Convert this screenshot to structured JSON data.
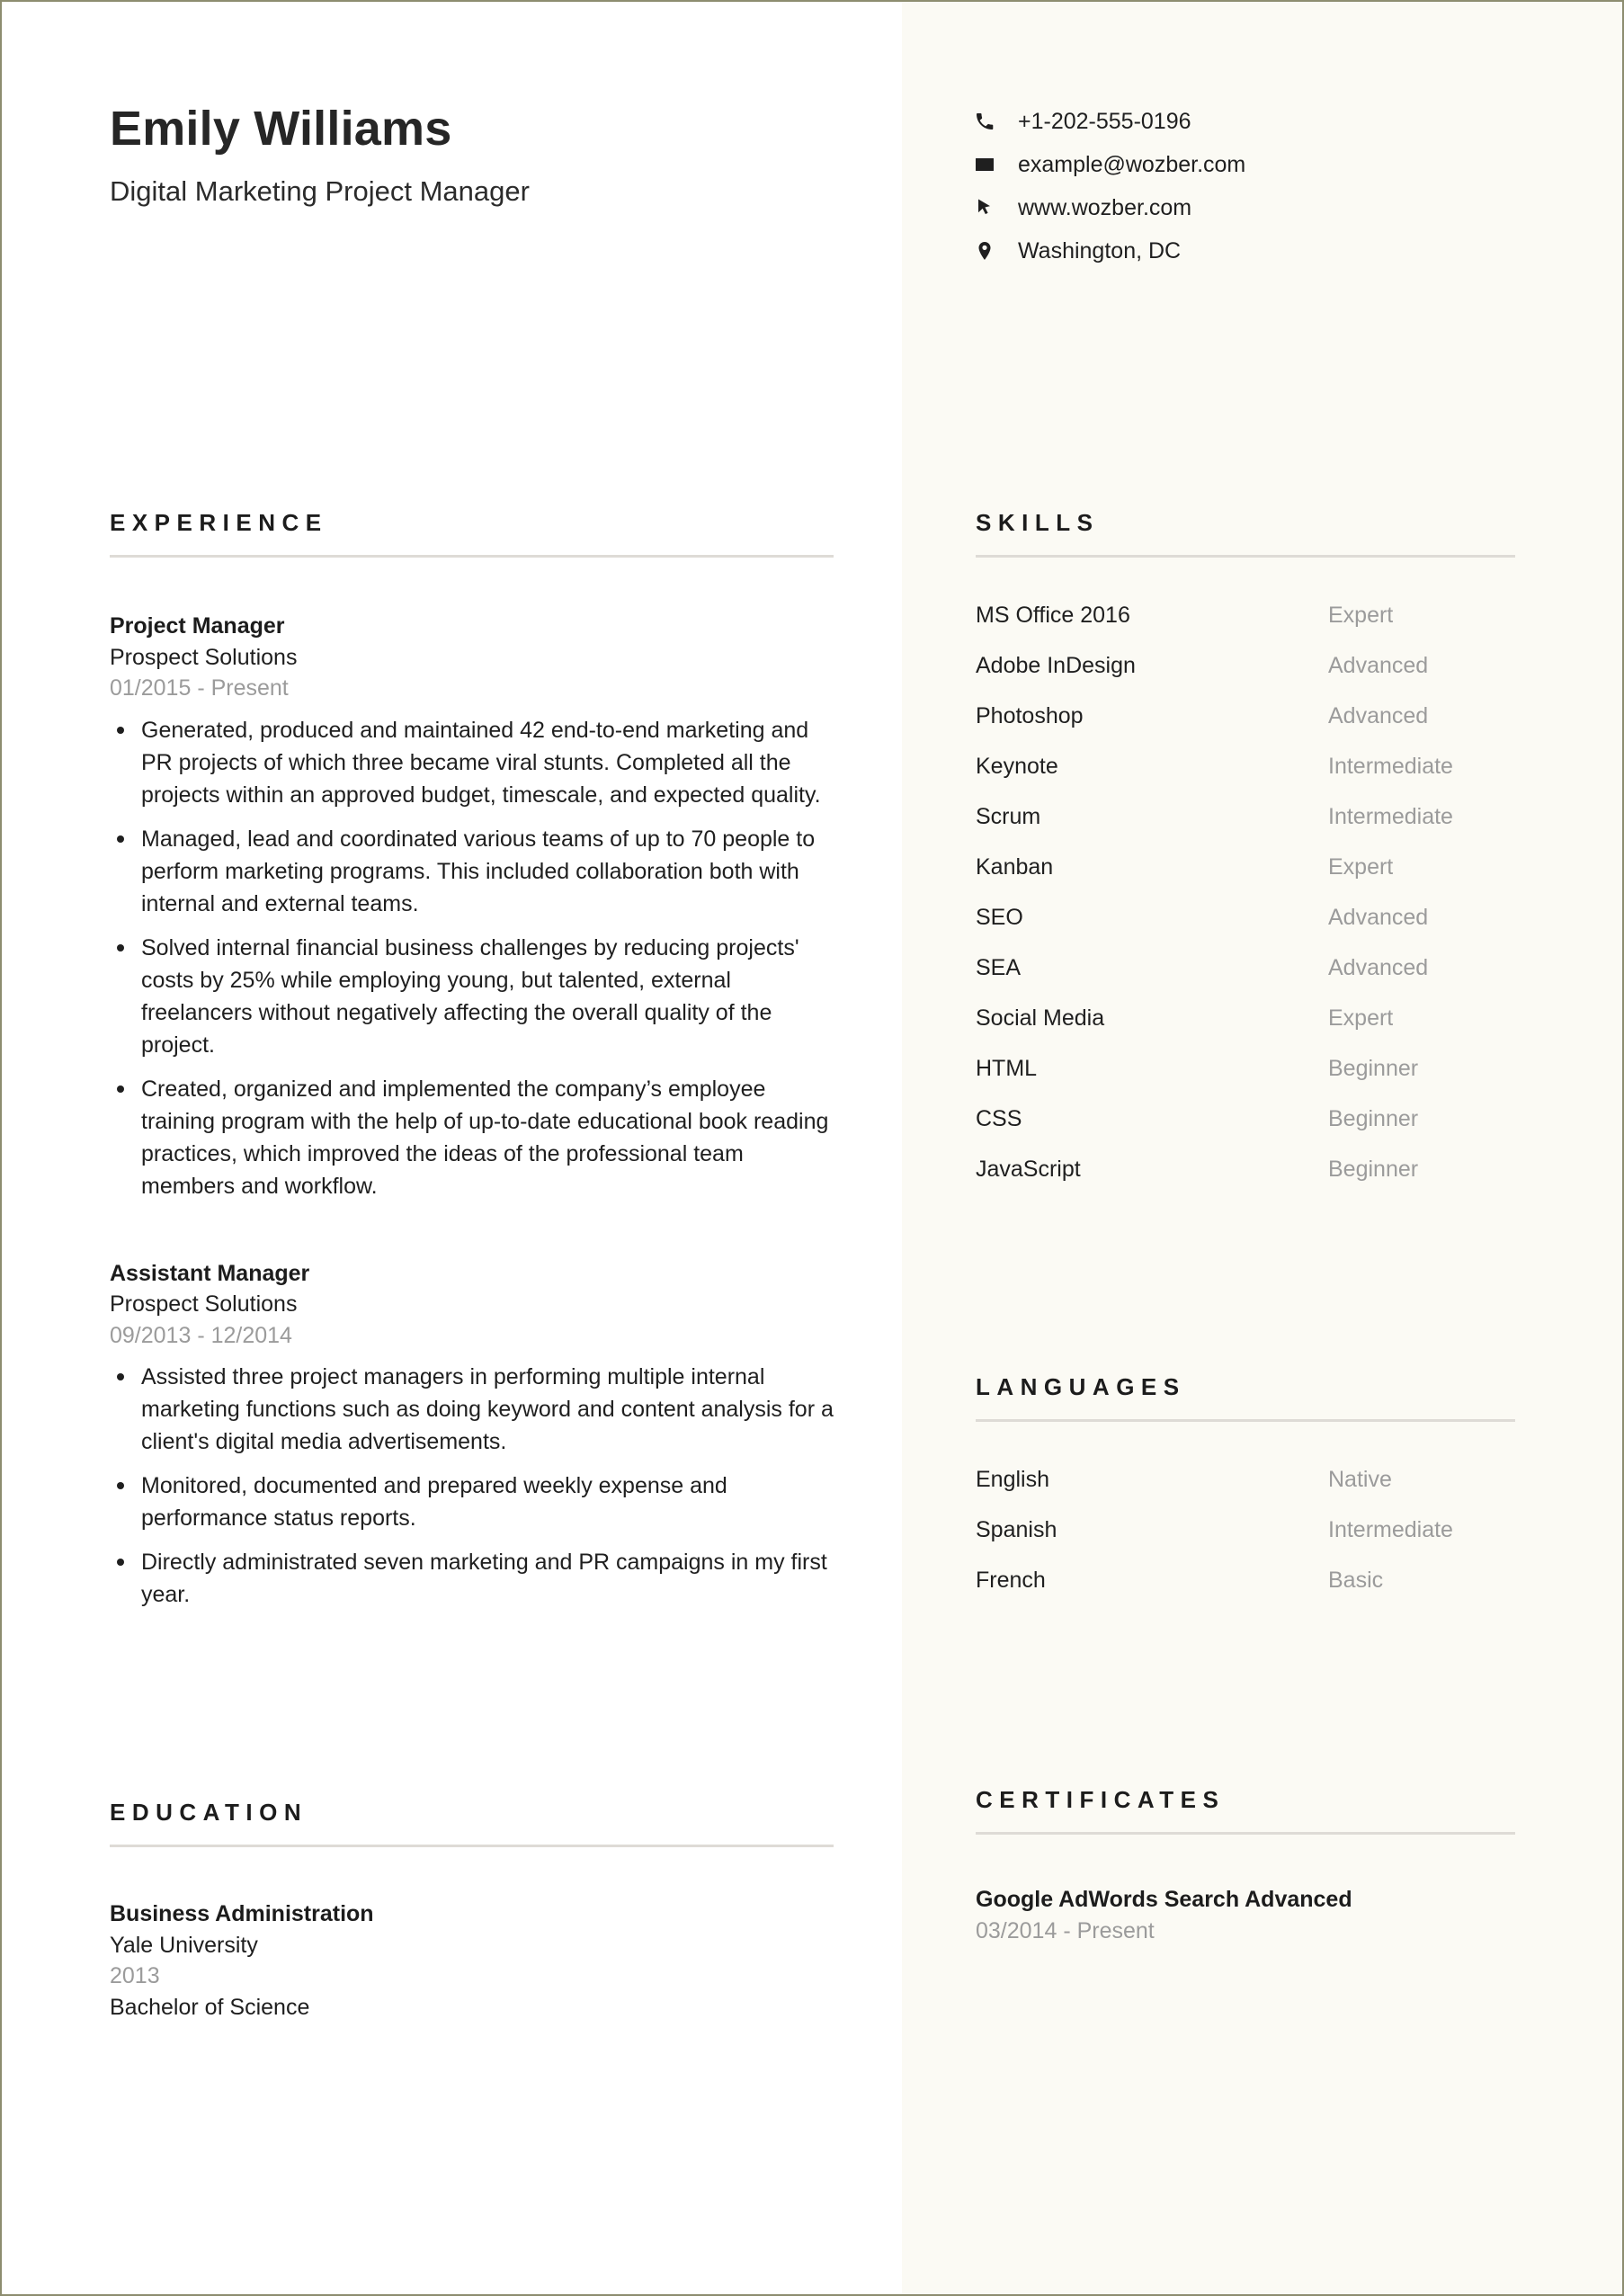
{
  "colors": {
    "page_border": "#8d8d70",
    "left_bg": "#ffffff",
    "right_bg": "#fbfaf4",
    "text": "#1f1f1f",
    "muted": "#9b9b9b",
    "rule": "#dedbd6"
  },
  "header": {
    "name": "Emily Williams",
    "job_title": "Digital Marketing Project Manager",
    "contacts": [
      {
        "icon": "phone-icon",
        "text": "+1-202-555-0196"
      },
      {
        "icon": "envelope-icon",
        "text": "example@wozber.com"
      },
      {
        "icon": "cursor-arrow-icon",
        "text": "www.wozber.com"
      },
      {
        "icon": "location-pin-icon",
        "text": "Washington, DC"
      }
    ]
  },
  "experience": {
    "heading": "EXPERIENCE",
    "entries": [
      {
        "title": "Project Manager",
        "organization": "Prospect Solutions",
        "date": "01/2015 - Present",
        "bullets": [
          "Generated, produced and maintained 42 end-to-end marketing and PR projects of which three became viral stunts. Completed all the projects within an approved budget, timescale, and expected quality.",
          "Managed, lead and coordinated various teams of up to 70 people to perform marketing programs. This included collaboration both with internal and external teams.",
          "Solved internal financial business challenges by reducing projects' costs by 25% while employing young, but talented, external freelancers without negatively affecting the overall quality of the project.",
          "Created, organized and implemented the company’s employee training program with the help of up-to-date educational book reading practices, which improved the ideas of the professional team members and workflow."
        ]
      },
      {
        "title": "Assistant Manager",
        "organization": "Prospect Solutions",
        "date": "09/2013 - 12/2014",
        "bullets": [
          "Assisted three project managers in performing multiple internal marketing functions such as doing keyword and content analysis for a client's digital media advertisements.",
          "Monitored, documented and prepared weekly expense and performance status reports.",
          "Directly administrated seven marketing and PR campaigns in my first year."
        ]
      }
    ]
  },
  "skills": {
    "heading": "SKILLS",
    "items": [
      {
        "name": "MS Office 2016",
        "level": "Expert"
      },
      {
        "name": "Adobe InDesign",
        "level": "Advanced"
      },
      {
        "name": "Photoshop",
        "level": "Advanced"
      },
      {
        "name": "Keynote",
        "level": "Intermediate"
      },
      {
        "name": "Scrum",
        "level": "Intermediate"
      },
      {
        "name": "Kanban",
        "level": "Expert"
      },
      {
        "name": "SEO",
        "level": "Advanced"
      },
      {
        "name": "SEA",
        "level": "Advanced"
      },
      {
        "name": "Social Media",
        "level": "Expert"
      },
      {
        "name": "HTML",
        "level": "Beginner"
      },
      {
        "name": "CSS",
        "level": "Beginner"
      },
      {
        "name": "JavaScript",
        "level": "Beginner"
      }
    ]
  },
  "languages": {
    "heading": "LANGUAGES",
    "items": [
      {
        "name": "English",
        "level": "Native"
      },
      {
        "name": "Spanish",
        "level": "Intermediate"
      },
      {
        "name": "French",
        "level": "Basic"
      }
    ]
  },
  "education": {
    "heading": "EDUCATION",
    "entries": [
      {
        "degree_field": "Business Administration",
        "institution": "Yale University",
        "year": "2013",
        "degree": "Bachelor of Science"
      }
    ]
  },
  "certificates": {
    "heading": "CERTIFICATES",
    "entries": [
      {
        "title": "Google AdWords Search Advanced",
        "date": "03/2014 - Present"
      }
    ]
  }
}
